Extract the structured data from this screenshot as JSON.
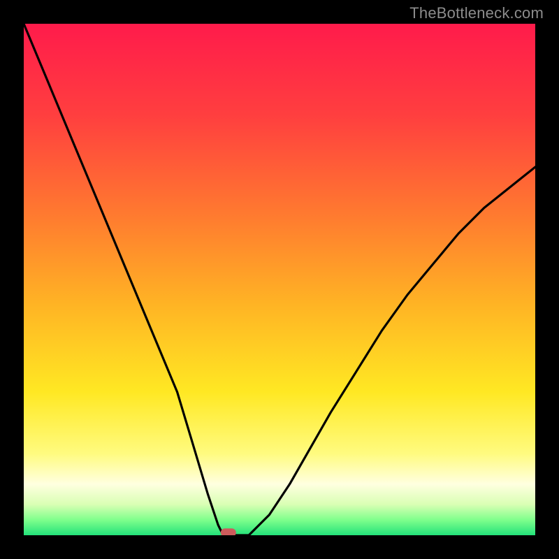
{
  "watermark": "TheBottleneck.com",
  "chart_data": {
    "type": "line",
    "title": "",
    "xlabel": "",
    "ylabel": "",
    "xlim": [
      0,
      100
    ],
    "ylim": [
      0,
      100
    ],
    "x": [
      0,
      5,
      10,
      15,
      20,
      25,
      30,
      33,
      36,
      38,
      39,
      40,
      44,
      48,
      52,
      56,
      60,
      65,
      70,
      75,
      80,
      85,
      90,
      95,
      100
    ],
    "y": [
      100,
      88,
      76,
      64,
      52,
      40,
      28,
      18,
      8,
      2,
      0,
      0,
      0,
      4,
      10,
      17,
      24,
      32,
      40,
      47,
      53,
      59,
      64,
      68,
      72
    ],
    "grid": false,
    "legend": false,
    "annotations": [
      {
        "type": "marker",
        "x": 40,
        "y": 0.5,
        "shape": "rounded-rect",
        "color": "#cd5c5c"
      }
    ],
    "background": "rainbow-gradient-vertical",
    "frame_color": "#000000"
  }
}
